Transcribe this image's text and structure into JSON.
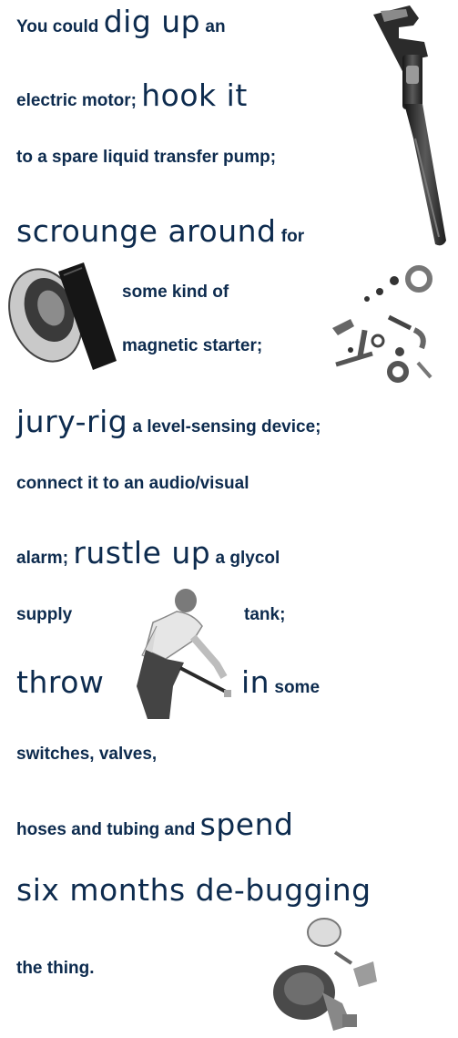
{
  "lines": [
    {
      "segs": [
        "You could ",
        "dig up",
        " an"
      ]
    },
    {
      "segs": [
        "electric motor; ",
        "hook it"
      ]
    },
    {
      "segs": [
        "to a spare liquid transfer pump;"
      ]
    },
    {
      "segs": [
        "scrounge around",
        " for"
      ]
    },
    {
      "segs": [
        "some kind of"
      ]
    },
    {
      "segs": [
        "magnetic starter;"
      ]
    },
    {
      "segs": [
        "jury-rig",
        " a level-sensing device;"
      ]
    },
    {
      "segs": [
        "connect it to an audio/visual"
      ]
    },
    {
      "segs": [
        "alarm; ",
        "rustle up",
        " a glycol"
      ]
    },
    {
      "segs": [
        "supply",
        "tank;"
      ]
    },
    {
      "segs": [
        "throw",
        "in",
        " some"
      ]
    },
    {
      "segs": [
        "switches, valves,"
      ]
    },
    {
      "segs": [
        "hoses and tubing and ",
        "spend"
      ]
    },
    {
      "segs": [
        "six months de-bugging"
      ]
    },
    {
      "segs": [
        "the thing."
      ]
    }
  ],
  "images": [
    "pipe-wrench-illustration",
    "electrical-tape-roll-illustration",
    "nuts-bolts-washers-illustration",
    "man-with-wrench-illustration",
    "motor-parts-illustration"
  ]
}
